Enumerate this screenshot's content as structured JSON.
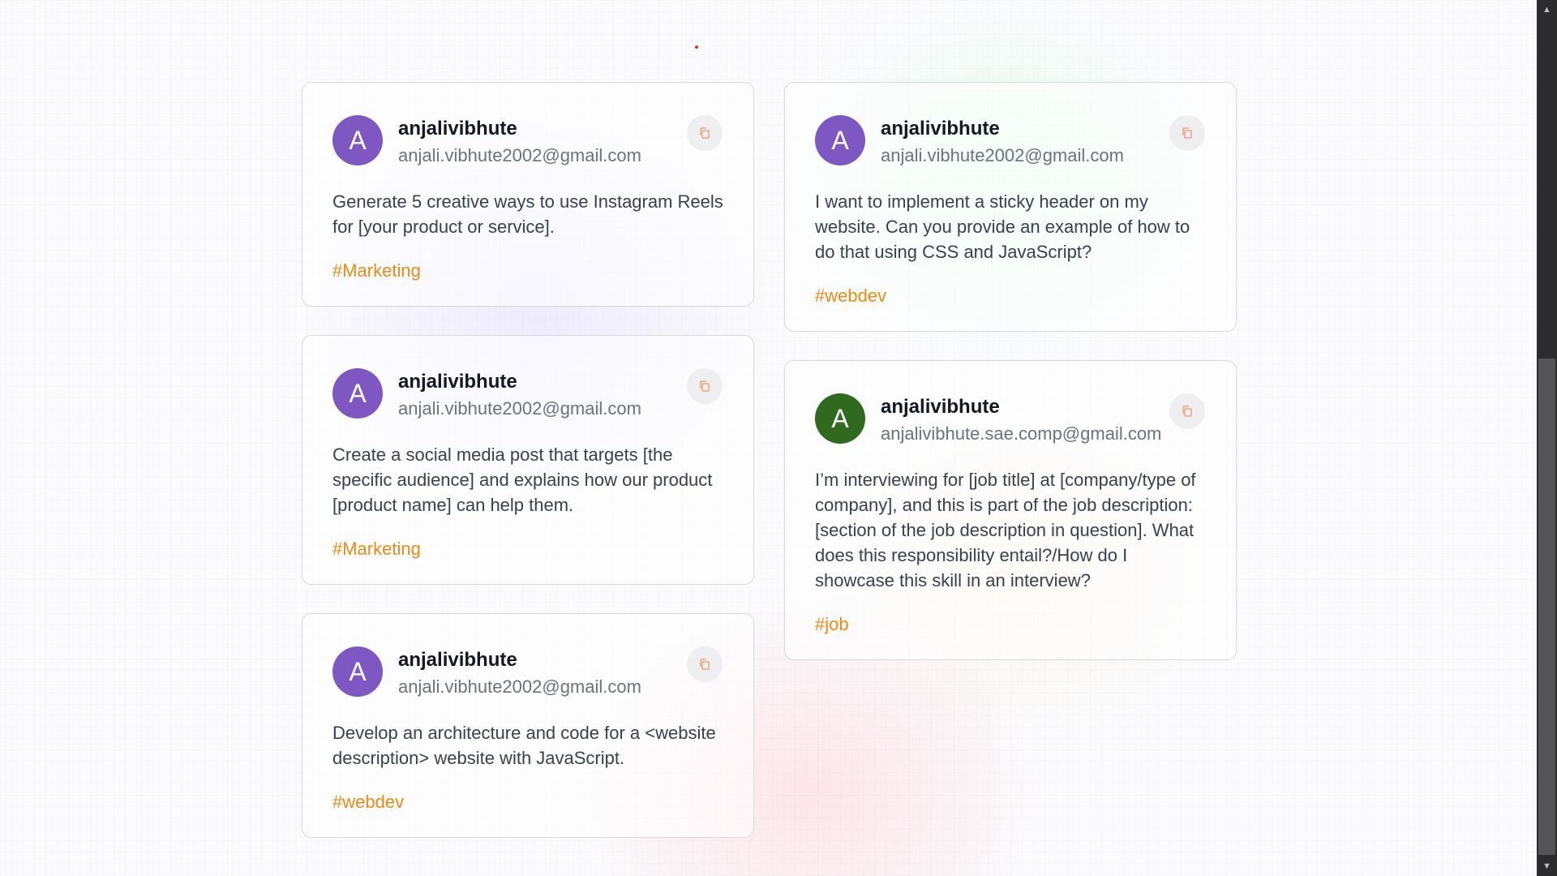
{
  "colors": {
    "tag": "#ec8a12",
    "avatar_purple": "#7e57c2",
    "avatar_green": "#2f6a1e",
    "copy_icon": "#f0946b"
  },
  "cards": [
    {
      "avatar_letter": "A",
      "avatar_color": "#7e57c2",
      "username": "anjalivibhute",
      "email": "anjali.vibhute2002@gmail.com",
      "prompt": "Generate 5 creative ways to use Instagram Reels for [your product or service].",
      "tag": "#Marketing",
      "copy_icon": "copy-icon"
    },
    {
      "avatar_letter": "A",
      "avatar_color": "#7e57c2",
      "username": "anjalivibhute",
      "email": "anjali.vibhute2002@gmail.com",
      "prompt": "I want to implement a sticky header on my website. Can you provide an example of how to do that using CSS and JavaScript?",
      "tag": "#webdev",
      "copy_icon": "copy-icon"
    },
    {
      "avatar_letter": "A",
      "avatar_color": "#7e57c2",
      "username": "anjalivibhute",
      "email": "anjali.vibhute2002@gmail.com",
      "prompt": "Create a social media post that targets [the specific audience] and explains how our product [product name] can help them.",
      "tag": "#Marketing",
      "copy_icon": "copy-icon"
    },
    {
      "avatar_letter": "A",
      "avatar_color": "#2f6a1e",
      "username": "anjalivibhute",
      "email": "anjalivibhute.sae.comp@gmail.com",
      "prompt": "I’m interviewing for [job title] at [company/type of company], and this is part of the job description: [section of the job description in question]. What does this responsibility entail?/How do I showcase this skill in an interview?",
      "tag": "#job",
      "copy_icon": "copy-icon"
    },
    {
      "avatar_letter": "A",
      "avatar_color": "#7e57c2",
      "username": "anjalivibhute",
      "email": "anjali.vibhute2002@gmail.com",
      "prompt": "Develop an architecture and code for a <website description> website with JavaScript.",
      "tag": "#webdev",
      "copy_icon": "copy-icon"
    }
  ]
}
